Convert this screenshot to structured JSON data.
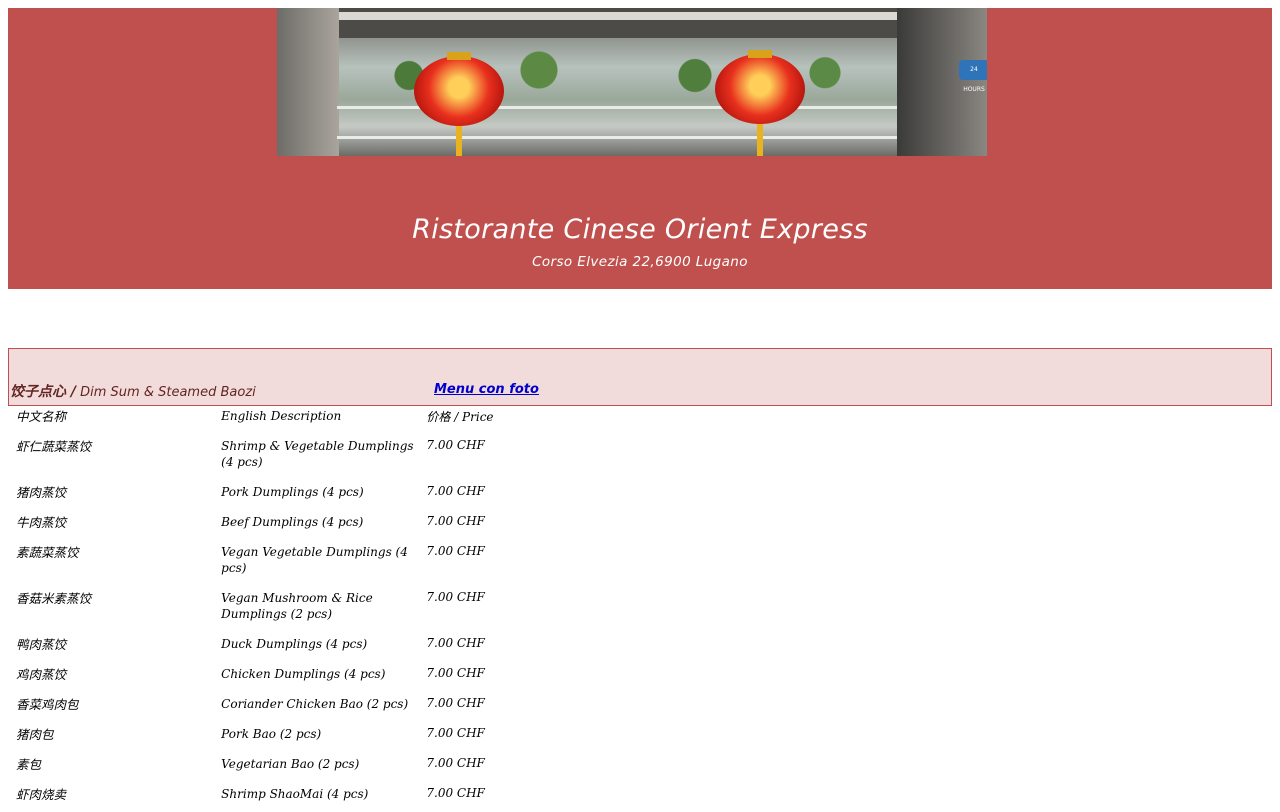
{
  "header": {
    "restaurant_name": "Ristorante Cinese Orient Express",
    "address": "Corso Elvezia 22,6900 Lugano",
    "colors": {
      "header_bg": "#c0504d",
      "section_bg": "#f2dcdb",
      "link": "#0000cc"
    }
  },
  "section": {
    "title_zh": "饺子点心 /",
    "title_en": "Dim Sum & Steamed Baozi",
    "photo_menu_link": " Menu con foto"
  },
  "table": {
    "headers": {
      "zh": "中文名称",
      "en": "English Description",
      "price": "价格 / Price"
    },
    "rows": [
      {
        "zh": "虾仁蔬菜蒸饺",
        "en": "Shrimp & Vegetable Dumplings (4 pcs)",
        "price": "7.00 CHF"
      },
      {
        "zh": "猪肉蒸饺",
        "en": "Pork Dumplings (4 pcs)",
        "price": "7.00 CHF"
      },
      {
        "zh": "牛肉蒸饺",
        "en": "Beef Dumplings (4 pcs)",
        "price": "7.00 CHF"
      },
      {
        "zh": "素蔬菜蒸饺",
        "en": "Vegan Vegetable Dumplings (4 pcs)",
        "price": "7.00 CHF"
      },
      {
        "zh": "香菇米素蒸饺",
        "en": "Vegan Mushroom & Rice Dumplings (2 pcs)",
        "price": "7.00 CHF"
      },
      {
        "zh": "鸭肉蒸饺",
        "en": "Duck Dumplings (4 pcs)",
        "price": "7.00 CHF"
      },
      {
        "zh": "鸡肉蒸饺",
        "en": "Chicken Dumplings (4 pcs)",
        "price": "7.00 CHF"
      },
      {
        "zh": "香菜鸡肉包",
        "en": "Coriander Chicken Bao (2 pcs)",
        "price": "7.00 CHF"
      },
      {
        "zh": "猪肉包",
        "en": "Pork Bao (2 pcs)",
        "price": "7.00 CHF"
      },
      {
        "zh": "素包",
        "en": "Vegetarian Bao (2 pcs)",
        "price": "7.00 CHF"
      },
      {
        "zh": "虾肉烧卖",
        "en": "Shrimp ShaoMai (4 pcs)",
        "price": "7.00 CHF"
      }
    ]
  },
  "icons": {
    "hero_image": "restaurant-window-photo-image"
  }
}
